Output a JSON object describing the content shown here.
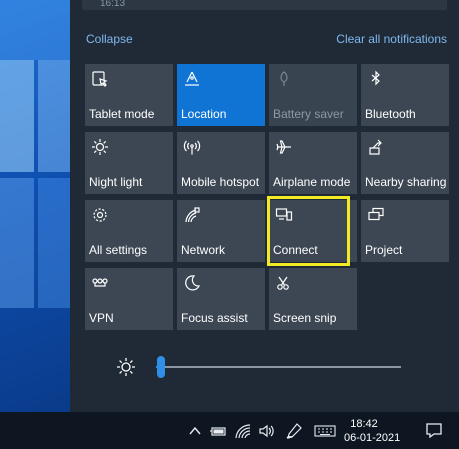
{
  "notification": {
    "time": "16:13"
  },
  "header": {
    "collapse_label": "Collapse",
    "clear_label": "Clear all notifications"
  },
  "tiles": [
    {
      "label": "Tablet mode",
      "icon": "tablet-mode-icon",
      "state": "off"
    },
    {
      "label": "Location",
      "icon": "location-icon",
      "state": "on"
    },
    {
      "label": "Battery saver",
      "icon": "battery-saver-icon",
      "state": "disabled"
    },
    {
      "label": "Bluetooth",
      "icon": "bluetooth-icon",
      "state": "off"
    },
    {
      "label": "Night light",
      "icon": "night-light-icon",
      "state": "off"
    },
    {
      "label": "Mobile hotspot",
      "icon": "mobile-hotspot-icon",
      "state": "off"
    },
    {
      "label": "Airplane mode",
      "icon": "airplane-icon",
      "state": "off"
    },
    {
      "label": "Nearby sharing",
      "icon": "nearby-sharing-icon",
      "state": "off"
    },
    {
      "label": "All settings",
      "icon": "gear-icon",
      "state": "off"
    },
    {
      "label": "Network",
      "icon": "network-icon",
      "state": "off"
    },
    {
      "label": "Connect",
      "icon": "connect-icon",
      "state": "off"
    },
    {
      "label": "Project",
      "icon": "project-icon",
      "state": "off"
    },
    {
      "label": "VPN",
      "icon": "vpn-icon",
      "state": "off"
    },
    {
      "label": "Focus assist",
      "icon": "moon-icon",
      "state": "off"
    },
    {
      "label": "Screen snip",
      "icon": "screen-snip-icon",
      "state": "off"
    }
  ],
  "brightness": {
    "level": 0.02,
    "icon": "sun-icon"
  },
  "taskbar": {
    "time": "18:42",
    "date": "06-01-2021",
    "tray_icons": [
      "chevron-up-icon",
      "battery-icon",
      "wifi-icon",
      "volume-icon",
      "pen-icon",
      "keyboard-icon"
    ],
    "notification_icon": "action-center-icon"
  },
  "colors": {
    "accent": "#0f74d4",
    "tile": "#3c4753",
    "panel": "#1f2a36",
    "highlight": "#f2ea25"
  }
}
